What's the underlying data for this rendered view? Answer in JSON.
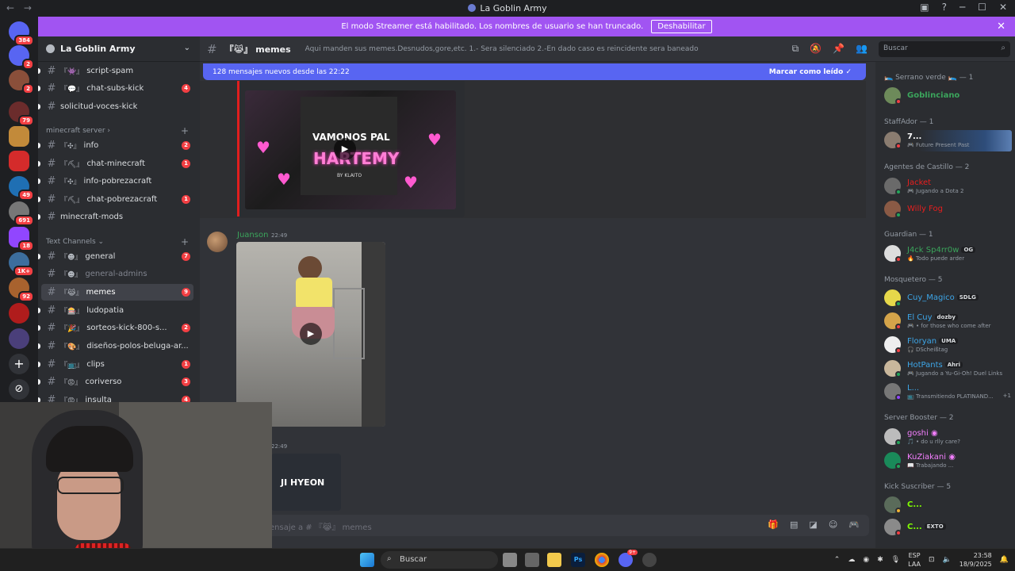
{
  "window": {
    "title": "La Goblin Army",
    "nav": "← →"
  },
  "banner": {
    "text": "El modo Streamer está habilitado. Los nombres de usuario se han truncado.",
    "button": "Deshabilitar",
    "close": "✕"
  },
  "rail": {
    "badges": [
      "384",
      "2",
      "2",
      "79",
      "49",
      "691",
      "18",
      "1K+",
      "92"
    ],
    "add": "+",
    "explore": "⊘"
  },
  "server": {
    "name": "La Goblin Army",
    "chevron": "⌄"
  },
  "channels": [
    {
      "emoji": "『👾』",
      "name": "script-spam",
      "count": ""
    },
    {
      "emoji": "『💬』",
      "name": "chat-subs-kick",
      "count": "4"
    },
    {
      "emoji": "",
      "name": "solicitud-voces-kick",
      "count": ""
    }
  ],
  "categories": {
    "minecraft": "minecraft server ›",
    "text": "Text Channels ⌄",
    "plus": "+"
  },
  "mc_channels": [
    {
      "emoji": "『✣』",
      "name": "info",
      "count": "2"
    },
    {
      "emoji": "『⛏』",
      "name": "chat-minecraft",
      "count": "1"
    },
    {
      "emoji": "『✣』",
      "name": "info-pobrezacraft",
      "count": ""
    },
    {
      "emoji": "『⛏』",
      "name": "chat-pobrezacraft",
      "count": "1"
    },
    {
      "emoji": "",
      "name": "minecraft-mods",
      "count": ""
    }
  ],
  "text_channels": [
    {
      "emoji": "『☻』",
      "name": "general",
      "count": "7"
    },
    {
      "emoji": "『☻』",
      "name": "general-admins",
      "count": ""
    },
    {
      "emoji": "『😹』",
      "name": "memes",
      "count": "9"
    },
    {
      "emoji": "『🎰』",
      "name": "ludopatia",
      "count": ""
    },
    {
      "emoji": "『🎉』",
      "name": "sorteos-kick-800-s...",
      "count": "2"
    },
    {
      "emoji": "『🎨』",
      "name": "diseños-polos-beluga-ar...",
      "count": ""
    },
    {
      "emoji": "『📺』",
      "name": "clips",
      "count": "1"
    },
    {
      "emoji": "『😡』",
      "name": "coriverso",
      "count": "3"
    },
    {
      "emoji": "『😡』",
      "name": "insulta",
      "count": "4"
    }
  ],
  "header": {
    "channel": "『😹』 memes",
    "topic": "Aqui manden sus memes.Desnudos,gore,etc. 1.- Sera silenciado 2.-En dado caso es reincidente sera baneado",
    "search_placeholder": "Buscar"
  },
  "chat": {
    "new_messages": "128 mensajes nuevos desde las 22:22",
    "mark_read": "Marcar como leído",
    "embed_title_1": "VAMONOS PAL",
    "embed_title_2": "HARTEMY",
    "embed_credit": "BY KLAITO",
    "author": "Juanson",
    "time": "22:49",
    "time2": "22:49",
    "second_text": "JI HYEON",
    "composer_placeholder": "ensaje a # 『😹』 memes"
  },
  "members": {
    "groups": [
      {
        "title": "🛌 Serrano verde 🛌 — 1"
      },
      {
        "title": "StaffAdor — 1"
      },
      {
        "title": "Agentes de Castillo — 2"
      },
      {
        "title": "Guardian — 1"
      },
      {
        "title": "Mosquetero — 5"
      },
      {
        "title": "Server Booster — 2"
      },
      {
        "title": "Kick Suscriber — 5"
      }
    ],
    "list": [
      {
        "name": "Goblinciano",
        "sub": "",
        "tag": "",
        "color": "#3ba55c",
        "status": "dnd"
      },
      {
        "name": "7...",
        "sub": "🎮 Future Present Past",
        "tag": "",
        "color": "#ffffff",
        "status": "dnd"
      },
      {
        "name": "Jacket",
        "sub": "🎮 Jugando a Dota 2",
        "tag": "",
        "color": "#e91e1e",
        "status": "online"
      },
      {
        "name": "Willy Fog",
        "sub": "",
        "tag": "",
        "color": "#e91e1e",
        "status": "online"
      },
      {
        "name": "J4ck Sp4rr0w",
        "sub": "🔥 Todo puede arder",
        "tag": "OG",
        "color": "#3ba55c",
        "status": "dnd"
      },
      {
        "name": "Cuy_Magico",
        "sub": "",
        "tag": "SDLG",
        "color": "#3da6e8",
        "status": "online"
      },
      {
        "name": "El Cuy",
        "sub": "🎮 • for those who come after",
        "tag": "dozby",
        "color": "#3da6e8",
        "status": "dnd"
      },
      {
        "name": "Floryan",
        "sub": "🎧 DScheißtag",
        "tag": "UMA",
        "color": "#3da6e8",
        "status": "dnd"
      },
      {
        "name": "HotPants",
        "sub": "🎮 Jugando a Yu-Gi-Oh! Duel Links",
        "tag": "Ahri",
        "color": "#3da6e8",
        "status": "online"
      },
      {
        "name": "L...",
        "sub": "📺 Transmitiendo PLATINAND...",
        "tag": "",
        "color": "#3da6e8",
        "status": "idle",
        "extra": "+1"
      },
      {
        "name": "goshi",
        "sub": "🎵 • do u rlly care?",
        "tag": "",
        "color": "#f47fff",
        "status": "online"
      },
      {
        "name": "KuZiakani",
        "sub": "📖 Trabajando ...",
        "tag": "",
        "color": "#f47fff",
        "status": "online"
      },
      {
        "name": "C...",
        "sub": "",
        "tag": "",
        "color": "#80ff00",
        "status": "idle"
      },
      {
        "name": "C...",
        "sub": "",
        "tag": "EXTO",
        "color": "#80ff00",
        "status": "dnd"
      }
    ]
  },
  "taskbar": {
    "search": "Buscar",
    "lang1": "ESP",
    "lang2": "LAA",
    "time": "23:58",
    "date": "18/9/2025",
    "discord_badge": "9+"
  }
}
